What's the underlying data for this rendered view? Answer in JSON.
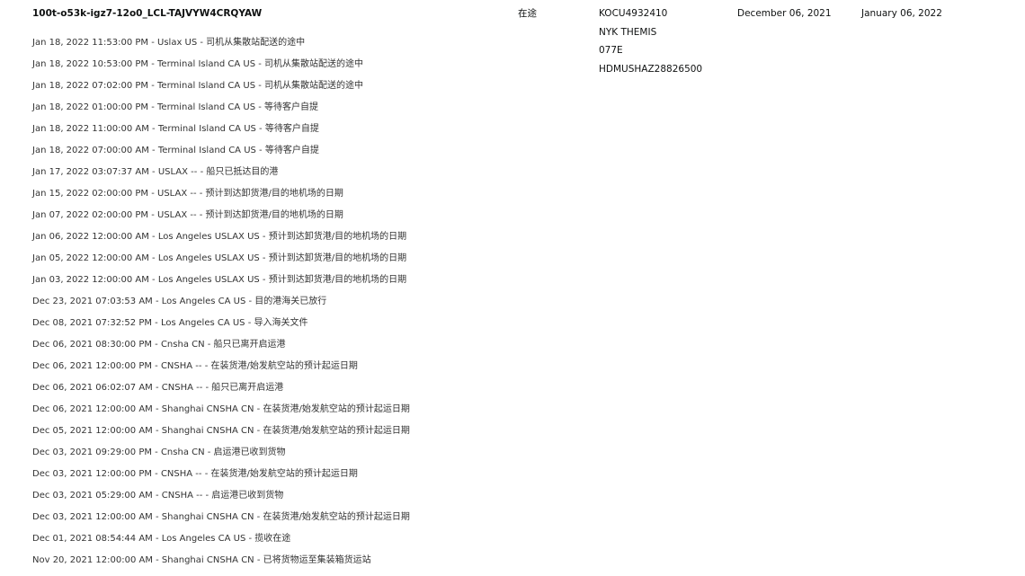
{
  "shipment": {
    "id": "100t-o53k-igz7-12o0_LCL-TAJVYW4CRQYAW",
    "status": "在途",
    "container": "KOCU4932410",
    "vessel": "NYK THEMIS",
    "voyage": "077E",
    "bill_of_lading": "HDMUSHAZ28826500",
    "start_date": "December 06, 2021",
    "end_date": "January 06, 2022"
  },
  "events": [
    "Jan 18, 2022 11:53:00 PM - Uslax US - 司机从集散站配送的途中",
    "Jan 18, 2022 10:53:00 PM - Terminal Island CA US - 司机从集散站配送的途中",
    "Jan 18, 2022 07:02:00 PM - Terminal Island CA US - 司机从集散站配送的途中",
    "Jan 18, 2022 01:00:00 PM - Terminal Island CA US - 等待客户自提",
    "Jan 18, 2022 11:00:00 AM - Terminal Island CA US - 等待客户自提",
    "Jan 18, 2022 07:00:00 AM - Terminal Island CA US - 等待客户自提",
    "Jan 17, 2022 03:07:37 AM - USLAX -- - 船只已抵达目的港",
    "Jan 15, 2022 02:00:00 PM - USLAX -- - 预计到达卸货港/目的地机场的日期",
    "Jan 07, 2022 02:00:00 PM - USLAX -- - 预计到达卸货港/目的地机场的日期",
    "Jan 06, 2022 12:00:00 AM - Los Angeles USLAX US - 预计到达卸货港/目的地机场的日期",
    "Jan 05, 2022 12:00:00 AM - Los Angeles USLAX US - 预计到达卸货港/目的地机场的日期",
    "Jan 03, 2022 12:00:00 AM - Los Angeles USLAX US - 预计到达卸货港/目的地机场的日期",
    "Dec 23, 2021 07:03:53 AM - Los Angeles CA US - 目的港海关已放行",
    "Dec 08, 2021 07:32:52 PM - Los Angeles CA US - 导入海关文件",
    "Dec 06, 2021 08:30:00 PM - Cnsha CN - 船只已离开启运港",
    "Dec 06, 2021 12:00:00 PM - CNSHA -- - 在装货港/始发航空站的预计起运日期",
    "Dec 06, 2021 06:02:07 AM - CNSHA -- - 船只已离开启运港",
    "Dec 06, 2021 12:00:00 AM - Shanghai CNSHA CN - 在装货港/始发航空站的预计起运日期",
    "Dec 05, 2021 12:00:00 AM - Shanghai CNSHA CN - 在装货港/始发航空站的预计起运日期",
    "Dec 03, 2021 09:29:00 PM - Cnsha CN - 启运港已收到货物",
    "Dec 03, 2021 12:00:00 PM - CNSHA -- - 在装货港/始发航空站的预计起运日期",
    "Dec 03, 2021 05:29:00 AM - CNSHA -- - 启运港已收到货物",
    "Dec 03, 2021 12:00:00 AM - Shanghai CNSHA CN - 在装货港/始发航空站的预计起运日期",
    "Dec 01, 2021 08:54:44 AM - Los Angeles CA US - 揽收在途",
    "Nov 20, 2021 12:00:00 AM - Shanghai CNSHA CN - 已将货物运至集装箱货运站"
  ]
}
